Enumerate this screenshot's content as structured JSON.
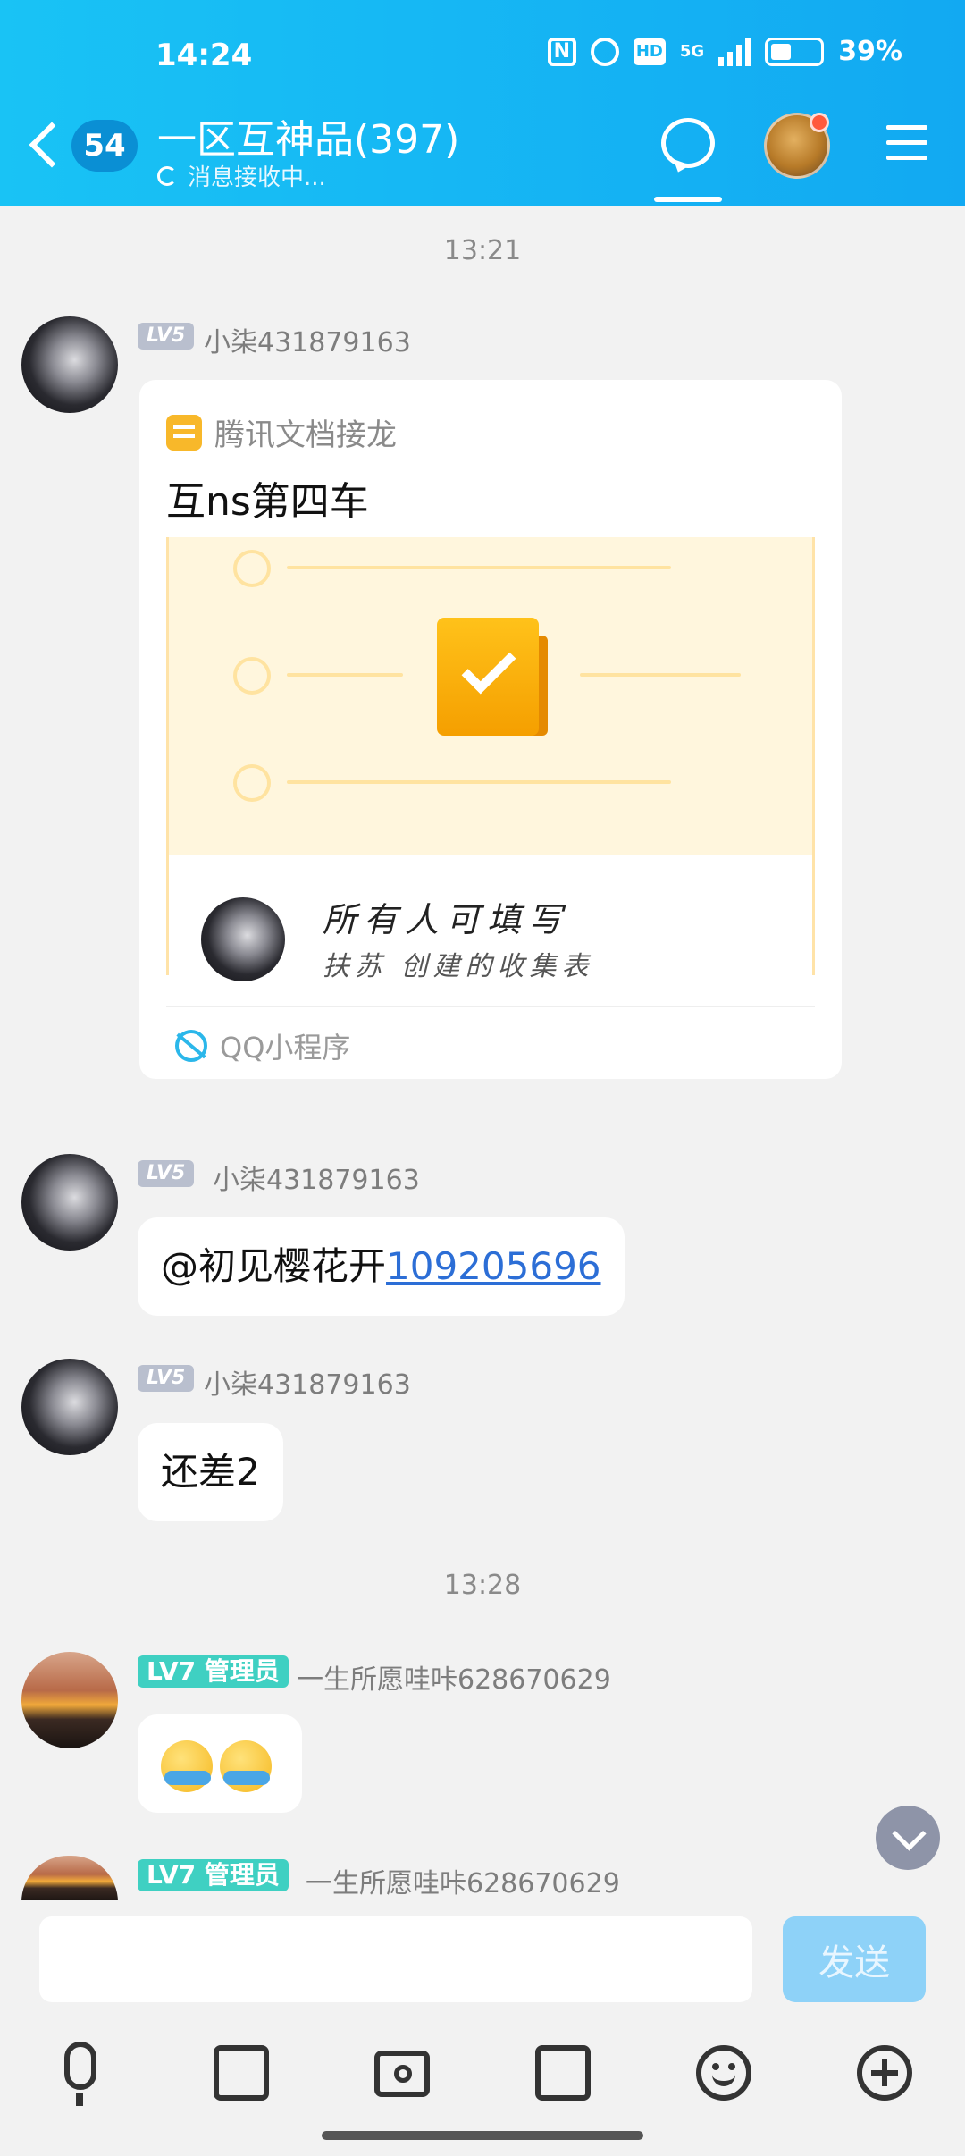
{
  "status_bar": {
    "time": "14:24",
    "network": "5G",
    "battery_percent": "39%",
    "hd": "HD",
    "nfc": "N"
  },
  "header": {
    "unread_count": "54",
    "title": "一区互神品(397)",
    "subtitle": "消息接收中..."
  },
  "timestamps": [
    "13:21",
    "13:28"
  ],
  "messages": [
    {
      "level": "LV5",
      "sender": "小柒431879163",
      "card": {
        "source": "腾讯文档接龙",
        "title": "互ns第四车",
        "preview_line1": "所有人可填写",
        "preview_line2": "扶苏 创建的收集表",
        "footer": "QQ小程序"
      }
    },
    {
      "level": "LV5",
      "sender": "小柒431879163",
      "text_prefix": "@初见樱花开",
      "link": "109205696"
    },
    {
      "level": "LV5",
      "sender": "小柒431879163",
      "text": "还差2"
    },
    {
      "level": "LV7 管理员",
      "sender": "一生所愿哇咔628670629",
      "emoji_count": 2
    },
    {
      "level": "LV7 管理员",
      "sender": "一生所愿哇咔628670629"
    }
  ],
  "composer": {
    "input_value": "",
    "send_label": "发送"
  },
  "icons": {
    "toolbar": [
      "microphone-icon",
      "image-icon",
      "camera-icon",
      "red-packet-icon",
      "emoji-icon",
      "plus-icon"
    ]
  }
}
